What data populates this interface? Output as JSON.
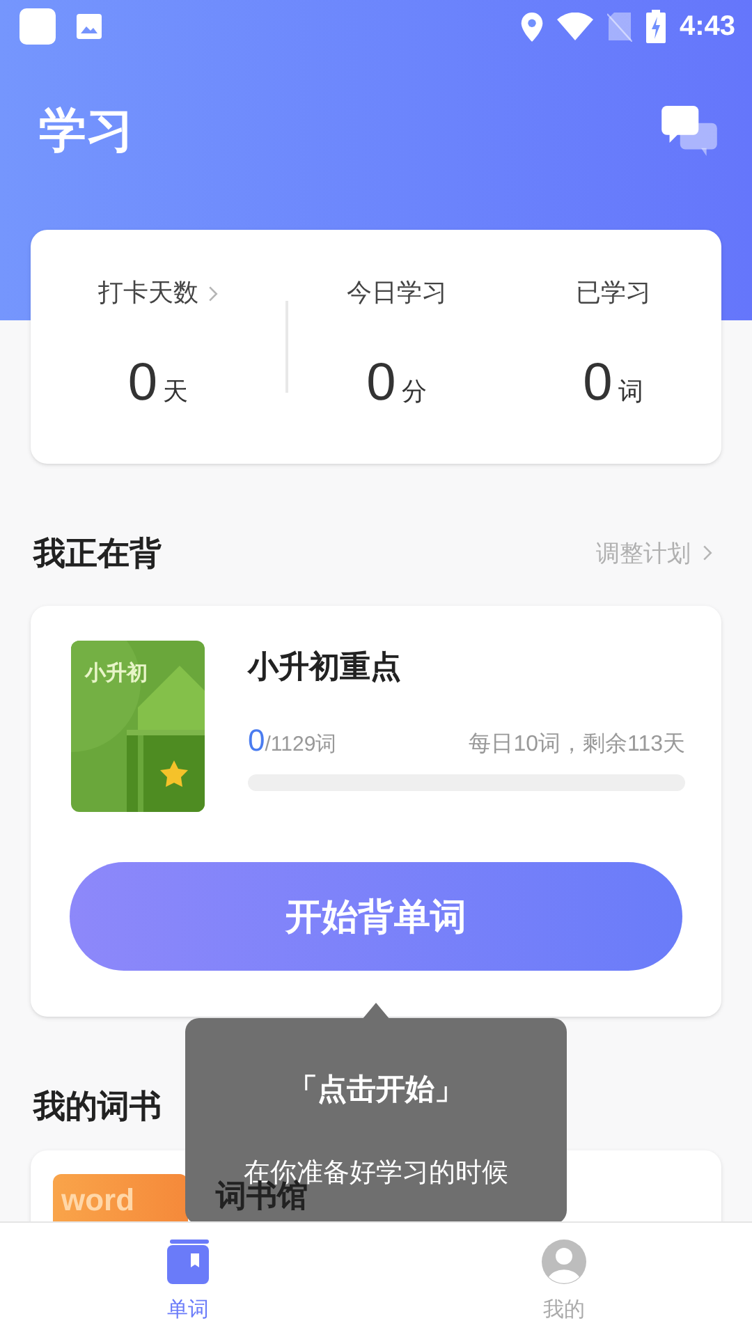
{
  "status_bar": {
    "time": "4:43"
  },
  "header": {
    "title": "学习"
  },
  "stats": [
    {
      "label": "打卡天数",
      "value": "0",
      "unit": "天",
      "link": true
    },
    {
      "label": "今日学习",
      "value": "0",
      "unit": "分",
      "link": false
    },
    {
      "label": "已学习",
      "value": "0",
      "unit": "词",
      "link": false
    }
  ],
  "current": {
    "heading": "我正在背",
    "action": "调整计划",
    "book": {
      "cover_label": "小升初",
      "title": "小升初重点",
      "learned": "0",
      "total": "/1129词",
      "plan": "每日10词，剩余113天",
      "level": 0
    },
    "start_button": "开始背单词"
  },
  "tooltip": {
    "title": "「点击开始」",
    "text": "在你准备好学习的时候"
  },
  "my_books": {
    "heading": "我的词书",
    "items": [
      {
        "cover_label": "word",
        "title": "词书馆"
      }
    ]
  },
  "tabs": [
    {
      "label": "单词",
      "selected": true
    },
    {
      "label": "我的",
      "selected": false
    }
  ]
}
